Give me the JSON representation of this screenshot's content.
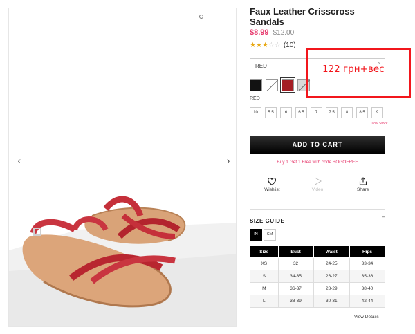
{
  "product": {
    "title": "Faux Leather Crisscross Sandals",
    "sale_price": "$8.99",
    "original_price": "$12.00",
    "rating_stars": 3,
    "rating_max": 5,
    "review_count": "(10)"
  },
  "gallery": {
    "prev_icon": "chevron-left-icon",
    "next_icon": "chevron-right-icon",
    "prev_glyph": "‹",
    "next_glyph": "›"
  },
  "color_select": {
    "value": "RED",
    "chevron": "ˇ"
  },
  "swatches": [
    {
      "color": "#121212",
      "cross": false,
      "selected": false
    },
    {
      "color": "#ffffff",
      "cross": true,
      "selected": false
    },
    {
      "color": "#a41d24",
      "cross": false,
      "selected": true
    },
    {
      "color": "#d8d8d8",
      "cross": true,
      "selected": false
    }
  ],
  "selected_color_label": "RED",
  "sizes": [
    "10",
    "5.5",
    "6",
    "6.5",
    "7",
    "7.5",
    "8",
    "8.5",
    "9"
  ],
  "low_stock_label": "Low Stock",
  "cart": {
    "add_label": "ADD TO CART",
    "promo": "Buy 1 Get 1 Free with code BOGOFREE"
  },
  "actions": [
    {
      "label": "Wishlist",
      "icon": "heart-icon",
      "enabled": true
    },
    {
      "label": "Video",
      "icon": "play-icon",
      "enabled": false
    },
    {
      "label": "Share",
      "icon": "share-icon",
      "enabled": true
    }
  ],
  "size_guide": {
    "title": "SIZE GUIDE",
    "toggle": "–",
    "units": [
      "IN",
      "CM"
    ],
    "active_unit": "IN",
    "headers": [
      "Size",
      "Bust",
      "Waist",
      "Hips"
    ],
    "rows": [
      [
        "XS",
        "32",
        "24-25",
        "33-34"
      ],
      [
        "S",
        "34-35",
        "26-27",
        "35-36"
      ],
      [
        "M",
        "36-37",
        "28-29",
        "38-40"
      ],
      [
        "L",
        "38-39",
        "30-31",
        "42-44"
      ]
    ],
    "view_details": "View Details"
  },
  "annotation": {
    "text": "122 грн+вес",
    "color": "#f2161c"
  },
  "colors": {
    "accent_pink": "#e6366a",
    "star_gold": "#e8a916"
  }
}
